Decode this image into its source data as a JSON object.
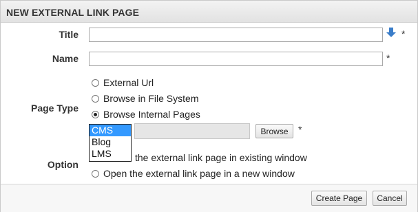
{
  "dialog": {
    "title": "NEW EXTERNAL LINK PAGE"
  },
  "form": {
    "title_label": "Title",
    "title_value": "",
    "title_required": "*",
    "name_label": "Name",
    "name_value": "",
    "name_required": "*",
    "page_type_label": "Page Type",
    "page_type_options": [
      "External Url",
      "Browse in File System",
      "Browse Internal Pages"
    ],
    "page_type_selected": "Browse Internal Pages",
    "internal_pages_dropdown": [
      "CMS",
      "Blog",
      "LMS"
    ],
    "internal_pages_selected": "CMS",
    "browse_label": "Browse",
    "browse_required": "*",
    "option_label": "Option",
    "option_choices": [
      "Open the external link page in existing window",
      "Open the external link page in a new window"
    ],
    "option_existing_partial": "the external link page in existing window"
  },
  "footer": {
    "create_label": "Create Page",
    "cancel_label": "Cancel"
  },
  "icons": {
    "title_action": "arrow-down-icon",
    "accent": "#3a7dc9"
  }
}
